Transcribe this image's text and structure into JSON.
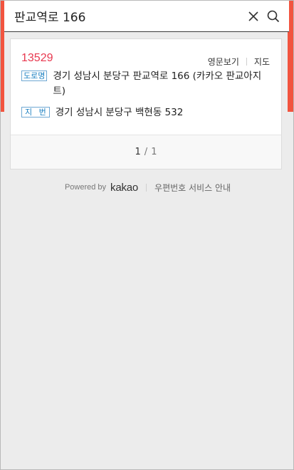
{
  "search": {
    "query": "판교역로 166"
  },
  "result": {
    "zipcode": "13529",
    "link_english": "영문보기",
    "link_map": "지도",
    "road_badge": "도로명",
    "road_address": "경기 성남시 분당구 판교역로 166 (카카오 판교아지트)",
    "jibun_badge": "지 번",
    "jibun_address": "경기 성남시 분당구 백현동 532"
  },
  "pager": {
    "current": "1",
    "separator": "/",
    "total": "1"
  },
  "footer": {
    "powered_by": "Powered by",
    "brand": "kakao",
    "service_guide": "우편번호 서비스 안내"
  },
  "colors": {
    "accent": "#f2543f",
    "zipcode": "#e8384f",
    "badge": "#1a7fc1",
    "background": "#ececec"
  },
  "icons": {
    "close": "close-icon",
    "search": "search-icon"
  }
}
